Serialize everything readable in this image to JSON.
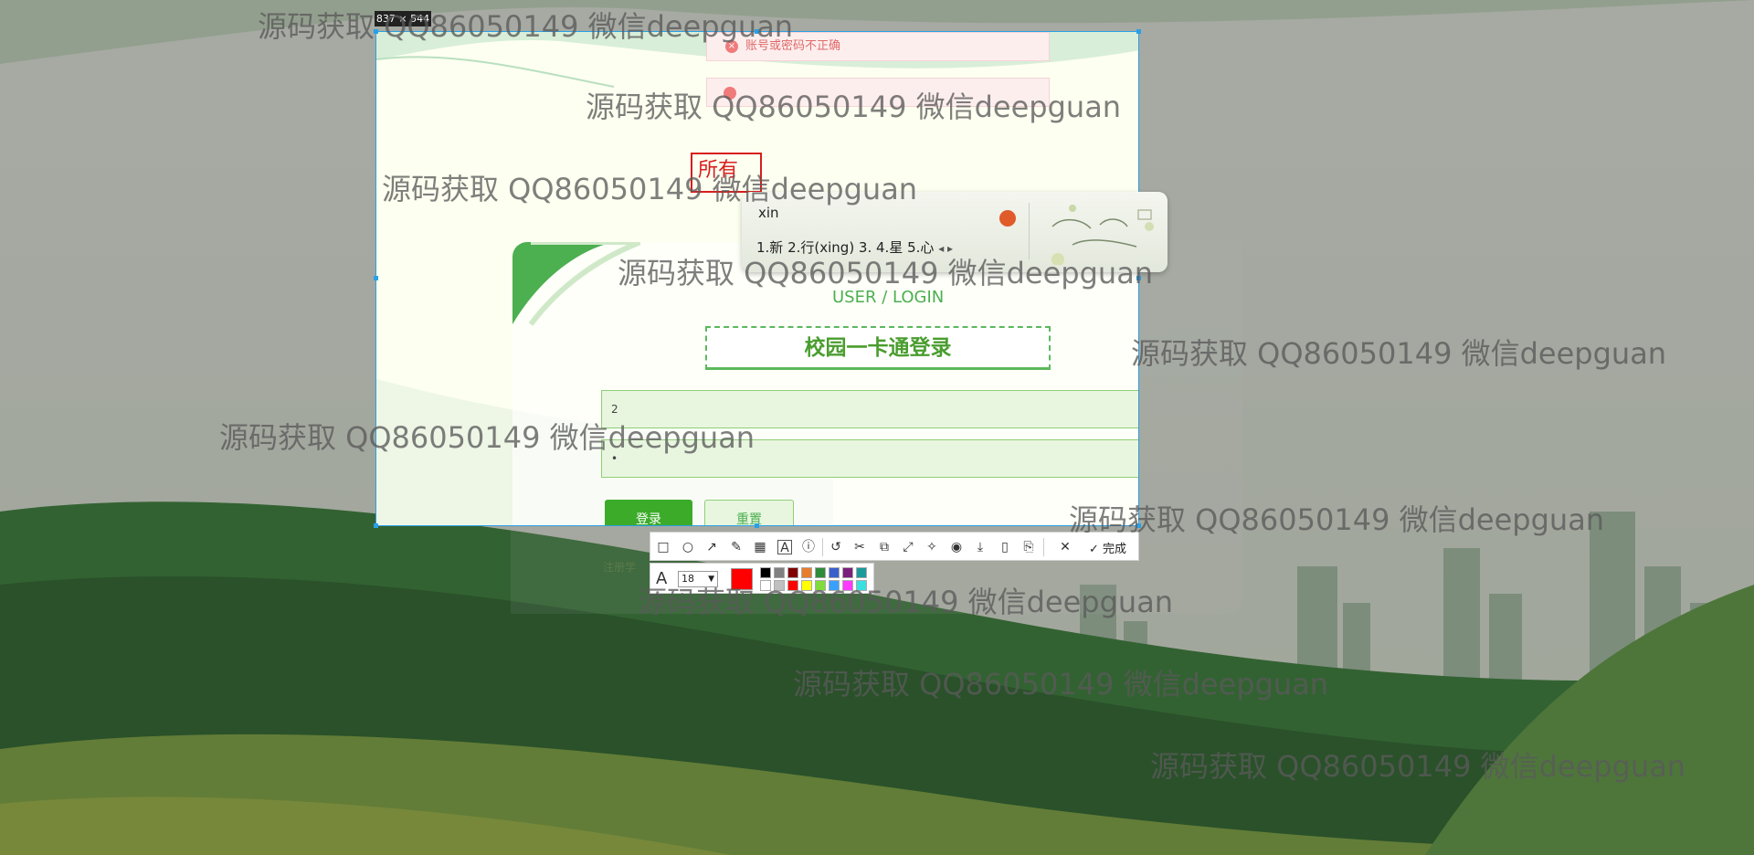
{
  "screenshot": {
    "size_label": "837 × 544"
  },
  "errors": {
    "first": "账号或密码不正确",
    "close_glyph": "×"
  },
  "stamp": {
    "text": "所有"
  },
  "login": {
    "subtitle": "USER / LOGIN",
    "title": "校园一卡通登录",
    "username_value": "2",
    "password_value": "•",
    "login_button": "登录",
    "reset_button": "重置",
    "register_text": "注册学"
  },
  "ime": {
    "input": "xin",
    "candidates": "1.新   2.行(xing)   3.      4.星   5.心",
    "arrows": "◂ ▸"
  },
  "toolbar": {
    "done_label": "完成",
    "font_size": "18",
    "font_glyph": "A",
    "icons": [
      "rectangle-icon",
      "ellipse-icon",
      "arrow-icon",
      "pen-icon",
      "mosaic-icon",
      "text-icon",
      "number-icon",
      "undo-icon",
      "crop-icon",
      "copy-icon",
      "expand-icon",
      "pin-icon",
      "record-icon",
      "download-icon",
      "phone-icon",
      "bookmark-icon",
      "close-icon",
      "check-icon"
    ],
    "current_color": "#ff0000",
    "palette_top": [
      "#000000",
      "#808080",
      "#800000",
      "#e87d2c",
      "#2e8b3a",
      "#3a5fcd",
      "#7a1f7a",
      "#1a9a9a"
    ],
    "palette_bottom": [
      "#ffffff",
      "#c0c0c0",
      "#ff0000",
      "#ffff00",
      "#7fdc3a",
      "#3aa0ff",
      "#ff3aff",
      "#3ae0e0"
    ]
  },
  "watermark": {
    "text": "源码获取 QQ86050149 微信deepguan"
  }
}
